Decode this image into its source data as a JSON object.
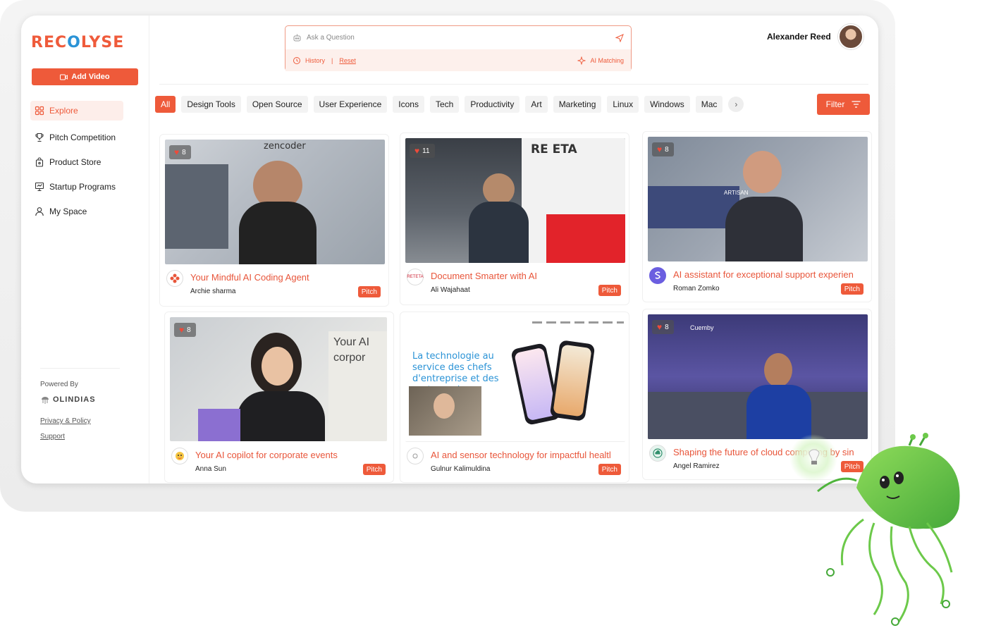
{
  "brand": {
    "logo_part1": "REC",
    "logo_part2": "O",
    "logo_part3": "LYSE"
  },
  "sidebar": {
    "add_video_label": "Add Video",
    "items": [
      {
        "label": "Explore",
        "icon": "grid-icon",
        "active": true
      },
      {
        "label": "Pitch Competition",
        "icon": "trophy-icon"
      },
      {
        "label": "Product Store",
        "icon": "bag-icon"
      },
      {
        "label": "Startup Programs",
        "icon": "presentation-icon"
      },
      {
        "label": "My Space",
        "icon": "user-icon"
      }
    ],
    "powered_by": "Powered By",
    "partner": "OLINDIAS",
    "privacy": "Privacy & Policy",
    "support": "Support"
  },
  "search": {
    "placeholder": "Ask a Question",
    "history": "History",
    "reset": "Reset",
    "ai_matching": "AI Matching"
  },
  "user": {
    "name": "Alexander Reed"
  },
  "tags": [
    "All",
    "Design Tools",
    "Open Source",
    "User Experience",
    "Icons",
    "Tech",
    "Productivity",
    "Art",
    "Marketing",
    "Linux",
    "Windows",
    "Mac"
  ],
  "filter_label": "Filter",
  "colors": {
    "accent": "#ee5a3a",
    "brand_blue": "#2b93d6"
  },
  "cards": [
    {
      "likes": "8",
      "title": "Your Mindful AI Coding Agent",
      "author": "Archie sharma",
      "pitch": "Pitch",
      "thumb_text": "zencoder"
    },
    {
      "likes": "11",
      "title": "Document Smarter with AI",
      "author": "Ali Wajahaat",
      "pitch": "Pitch",
      "thumb_text": "RE ETA",
      "logo_text": "RETETA"
    },
    {
      "likes": "8",
      "title": "AI assistant for exceptional support experien",
      "author": "Roman Zomko",
      "pitch": "Pitch",
      "thumb_text": "ARTISAN"
    },
    {
      "likes": "8",
      "title": "Your AI copilot for corporate events",
      "author": "Anna Sun",
      "pitch": "Pitch",
      "thumb_text": "Your AI corpor"
    },
    {
      "likes": "",
      "title": "AI and sensor technology for impactful healtl",
      "author": "Gulnur Kalimuldina",
      "pitch": "Pitch",
      "thumb_text": "La technologie au service des chefs d'entreprise et des porteurs de"
    },
    {
      "likes": "8",
      "title": "Shaping the future of cloud computing by sin",
      "author": "Angel Ramirez",
      "pitch": "Pitch",
      "thumb_text": "Cuemby"
    }
  ]
}
